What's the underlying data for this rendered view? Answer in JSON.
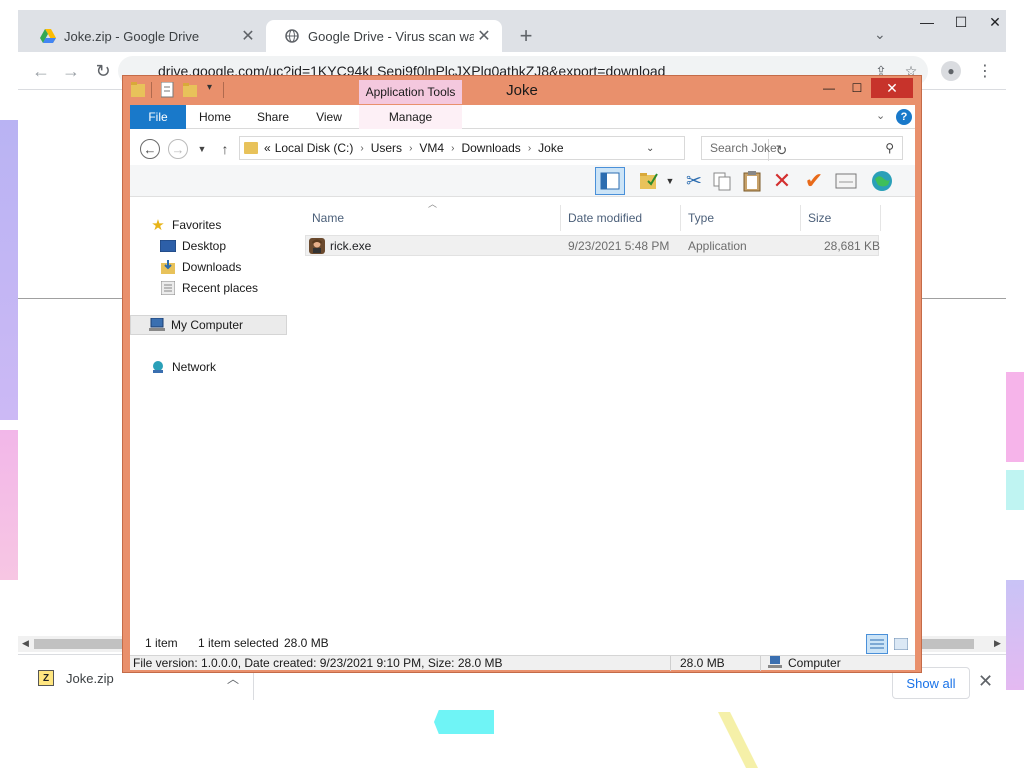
{
  "browser": {
    "tabs": [
      {
        "title": "Joke.zip - Google Drive",
        "icon": "google-drive-icon"
      },
      {
        "title": "Google Drive - Virus scan warning",
        "icon": "globe-icon"
      }
    ],
    "url": "drive.google.com/uc?id=1KYC94kLSepj9f0lnPlcJXPlq0athkZJ8&export=download",
    "downloads": {
      "item_name": "Joke.zip",
      "show_all_label": "Show all"
    }
  },
  "explorer": {
    "title": "Joke",
    "contextual_tab_group": "Application Tools",
    "ribbon_tabs": [
      "File",
      "Home",
      "Share",
      "View",
      "Manage"
    ],
    "breadcrumb": {
      "prefix": "«",
      "crumbs": [
        "Local Disk (C:)",
        "Users",
        "VM4",
        "Downloads",
        "Joke"
      ]
    },
    "search_placeholder": "Search Joke",
    "nav": {
      "favorites": "Favorites",
      "desktop": "Desktop",
      "downloads": "Downloads",
      "recent": "Recent places",
      "computer": "My Computer",
      "network": "Network"
    },
    "columns": [
      "Name",
      "Date modified",
      "Type",
      "Size"
    ],
    "files": [
      {
        "name": "rick.exe",
        "date": "9/23/2021 5:48 PM",
        "type": "Application",
        "size": "28,681 KB"
      }
    ],
    "status": {
      "count": "1 item",
      "selected": "1 item selected",
      "selected_size": "28.0 MB"
    },
    "details": {
      "info": "File version: 1.0.0.0, Date created: 9/23/2021 9:10 PM, Size: 28.0 MB",
      "size": "28.0 MB",
      "location": "Computer"
    }
  },
  "colors": {
    "explorer_frame": "#e9906c",
    "close_button": "#c7332b",
    "file_tab": "#1979ca",
    "contextual_tab": "#f4c8de",
    "link_blue": "#1a73e8"
  }
}
